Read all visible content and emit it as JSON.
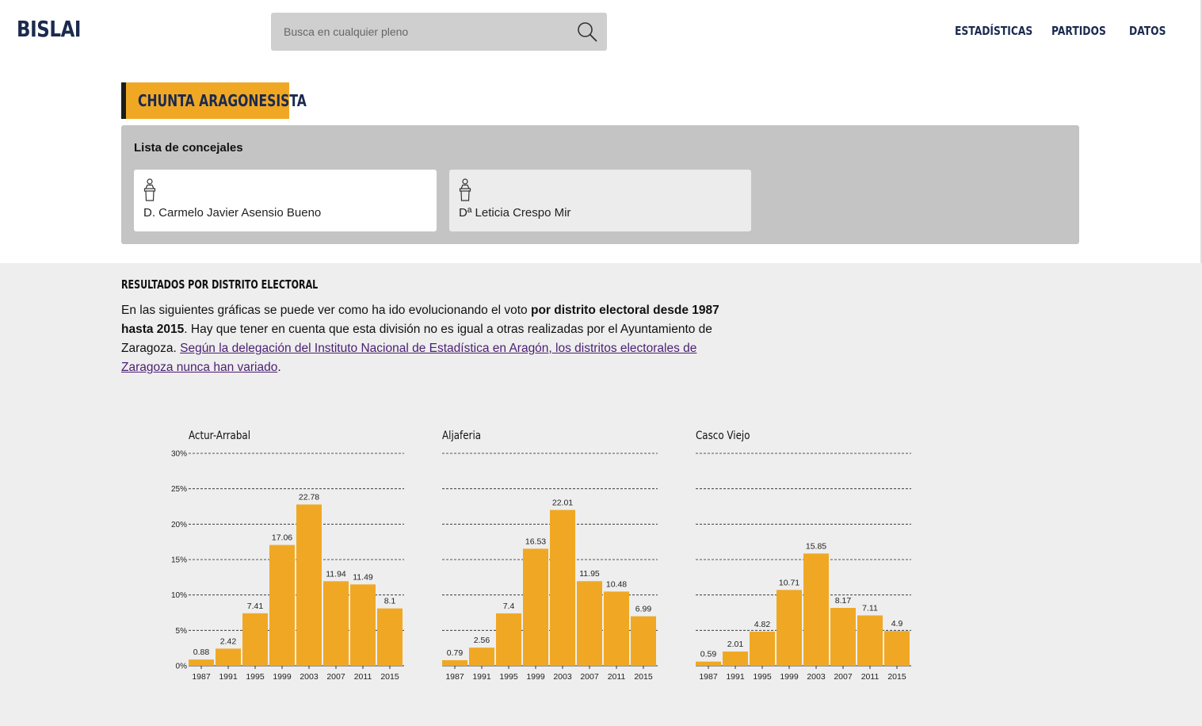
{
  "header": {
    "logo": "BISLAI",
    "search_placeholder": "Busca en cualquier pleno",
    "nav": [
      "ESTADÍSTICAS",
      "PARTIDOS",
      "DATOS"
    ]
  },
  "party": {
    "name": "CHUNTA ARAGONESISTA",
    "color": "#f0a824"
  },
  "council": {
    "title": "Lista de concejales",
    "members": [
      "D. Carmelo Javier Asensio Bueno",
      "Dª Leticia Crespo Mir"
    ]
  },
  "results": {
    "title": "RESULTADOS POR DISTRITO ELECTORAL",
    "intro_1": "En las siguientes gráficas se puede ver como ha ido evolucionando el voto ",
    "intro_bold": "por distrito electoral desde 1987 hasta 2015",
    "intro_2": ". Hay que tener en cuenta que esta división no es igual a otras realizadas por el Ayuntamiento de Zaragoza. ",
    "intro_link": "Según la delegación del Instituto Nacional de Estadística en Aragón, los distritos electorales de Zaragoza nunca han variado",
    "intro_end": "."
  },
  "chart_data": [
    {
      "type": "bar",
      "title": "Actur-Arrabal",
      "categories": [
        "1987",
        "1991",
        "1995",
        "1999",
        "2003",
        "2007",
        "2011",
        "2015"
      ],
      "values": [
        0.88,
        2.42,
        7.41,
        17.06,
        22.78,
        11.94,
        11.49,
        8.1
      ],
      "value_labels": [
        "0.88",
        "2.42",
        "7.41",
        "17.06",
        "22.78",
        "11.94",
        "11.49",
        "8.1"
      ],
      "ylim": [
        0,
        30
      ],
      "yticks": [
        "0%",
        "5%",
        "10%",
        "15%",
        "20%",
        "25%",
        "30%"
      ],
      "show_ytick_labels": true,
      "grid": true,
      "color": "#f0a824"
    },
    {
      "type": "bar",
      "title": "Aljaferia",
      "categories": [
        "1987",
        "1991",
        "1995",
        "1999",
        "2003",
        "2007",
        "2011",
        "2015"
      ],
      "values": [
        0.79,
        2.56,
        7.4,
        16.53,
        22.01,
        11.95,
        10.48,
        6.99
      ],
      "value_labels": [
        "0.79",
        "2.56",
        "7.4",
        "16.53",
        "22.01",
        "11.95",
        "10.48",
        "6.99"
      ],
      "ylim": [
        0,
        30
      ],
      "show_ytick_labels": false,
      "grid": true,
      "color": "#f0a824"
    },
    {
      "type": "bar",
      "title": "Casco Viejo",
      "categories": [
        "1987",
        "1991",
        "1995",
        "1999",
        "2003",
        "2007",
        "2011",
        "2015"
      ],
      "values": [
        0.59,
        2.01,
        4.82,
        10.71,
        15.85,
        8.17,
        7.11,
        4.9
      ],
      "value_labels": [
        "0.59",
        "2.01",
        "4.82",
        "10.71",
        "15.85",
        "8.17",
        "7.11",
        "4.9"
      ],
      "ylim": [
        0,
        30
      ],
      "show_ytick_labels": false,
      "grid": true,
      "color": "#f0a824"
    }
  ]
}
